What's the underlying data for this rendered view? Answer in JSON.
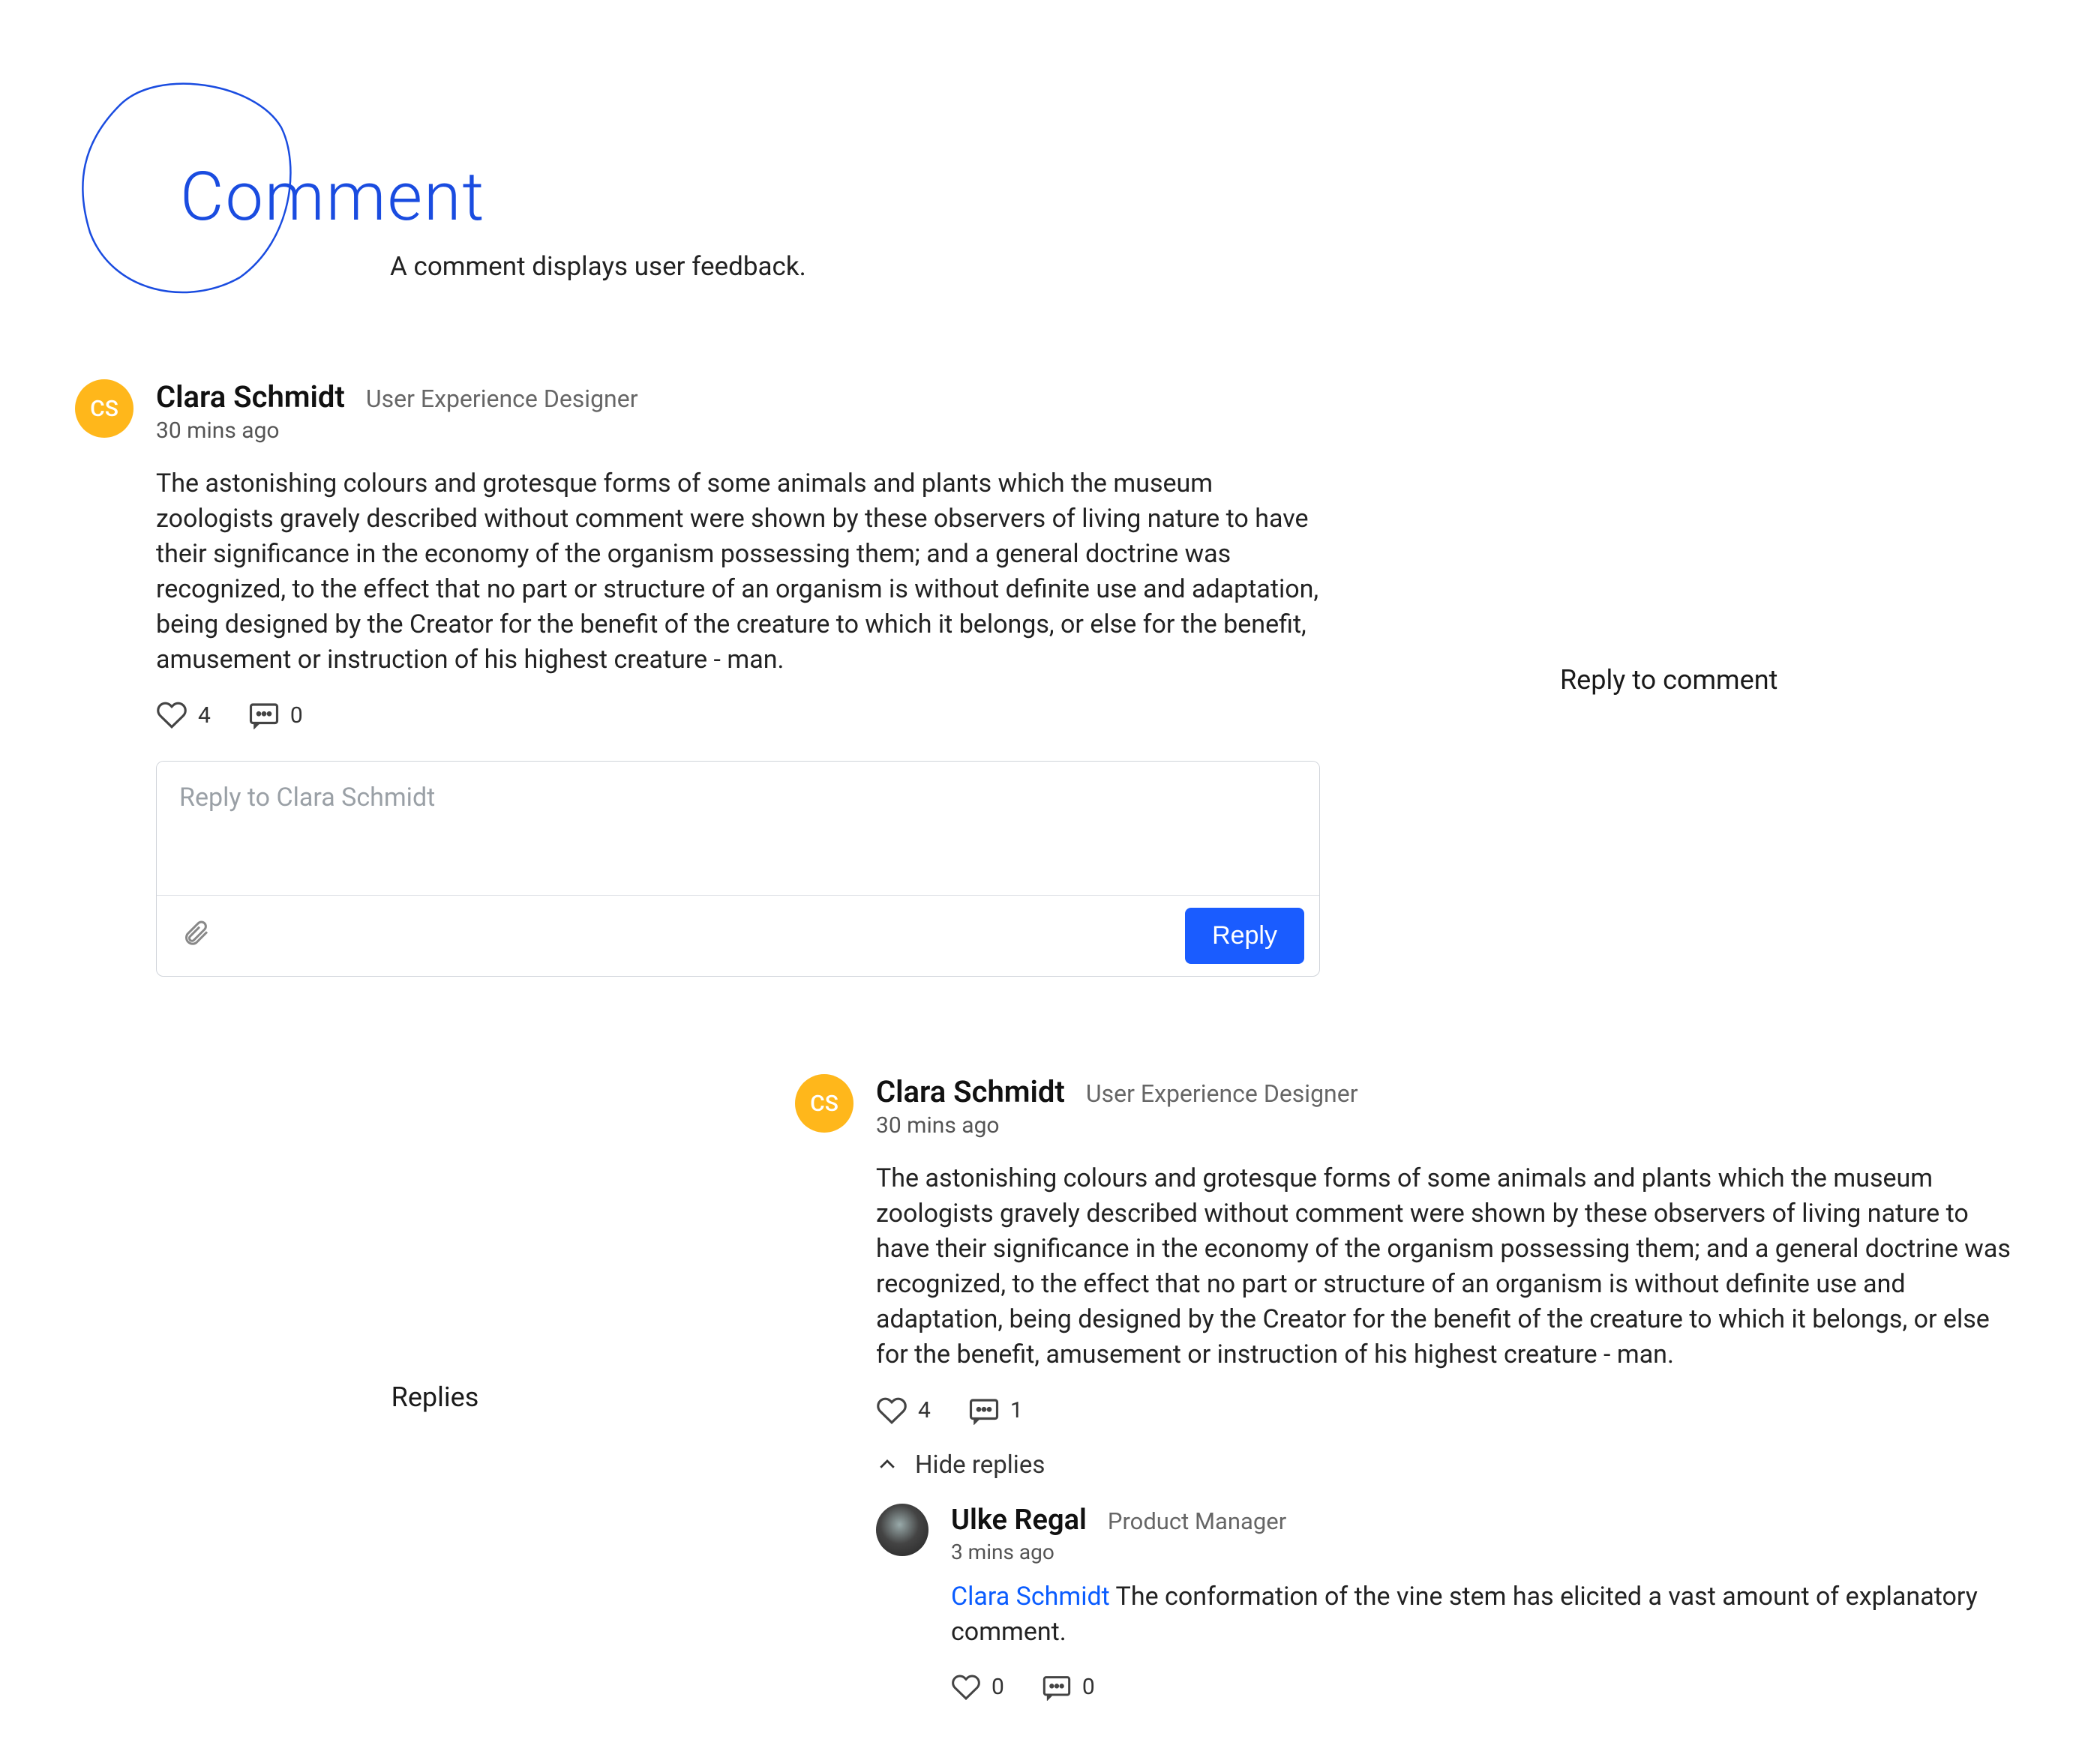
{
  "page": {
    "title": "Comment",
    "subtitle": "A comment displays user feedback."
  },
  "sections": {
    "reply_to_comment_label": "Reply to comment",
    "replies_label": "Replies"
  },
  "comment1": {
    "avatar_initials": "CS",
    "author_name": "Clara Schmidt",
    "author_role": "User Experience Designer",
    "timestamp": "30 mins ago",
    "text": "The astonishing colours and grotesque forms of some animals and plants which the museum zoologists gravely described without comment were shown by these observers of living nature to have their significance in the economy of the organism possessing them; and a general doctrine was recognized, to the effect that no part or structure of an organism is without definite use and adaptation, being designed by the Creator for the benefit of the creature to which it belongs, or else for the benefit, amusement or instruction of his highest creature - man.",
    "likes": "4",
    "replies": "0",
    "reply_placeholder": "Reply to Clara Schmidt",
    "reply_button": "Reply"
  },
  "comment2": {
    "avatar_initials": "CS",
    "author_name": "Clara Schmidt",
    "author_role": "User Experience Designer",
    "timestamp": "30 mins ago",
    "text": "The astonishing colours and grotesque forms of some animals and plants which the museum zoologists gravely described without comment were shown by these observers of living nature to have their significance in the economy of the organism possessing them; and a general doctrine was recognized, to the effect that no part or structure of an organism is without definite use and adaptation, being designed by the Creator for the benefit of the creature to which it belongs, or else for the benefit, amusement or instruction of his highest creature - man.",
    "likes": "4",
    "replies": "1",
    "hide_replies_label": "Hide replies",
    "reply1": {
      "author_name": "Ulke Regal",
      "author_role": "Product Manager",
      "timestamp": "3 mins ago",
      "mention": "Clara Schmidt",
      "text": " The conformation of the vine stem has elicited a vast amount of explanatory comment.",
      "likes": "0",
      "replies": "0"
    }
  }
}
